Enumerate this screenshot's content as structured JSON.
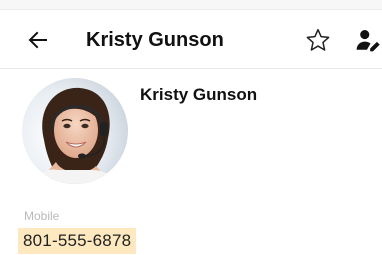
{
  "appbar": {
    "title": "Kristy Gunson",
    "back_icon": "arrow-left-icon",
    "favorite_icon": "star-outline-icon",
    "contact_icon": "person-edit-icon"
  },
  "contact": {
    "name": "Kristy Gunson",
    "avatar_icon": "contact-photo"
  },
  "fields": {
    "mobile": {
      "label": "Mobile",
      "value": "801-555-6878"
    }
  },
  "colors": {
    "highlight": "#fde8bf",
    "label": "#b9b9b9",
    "text": "#111111"
  }
}
